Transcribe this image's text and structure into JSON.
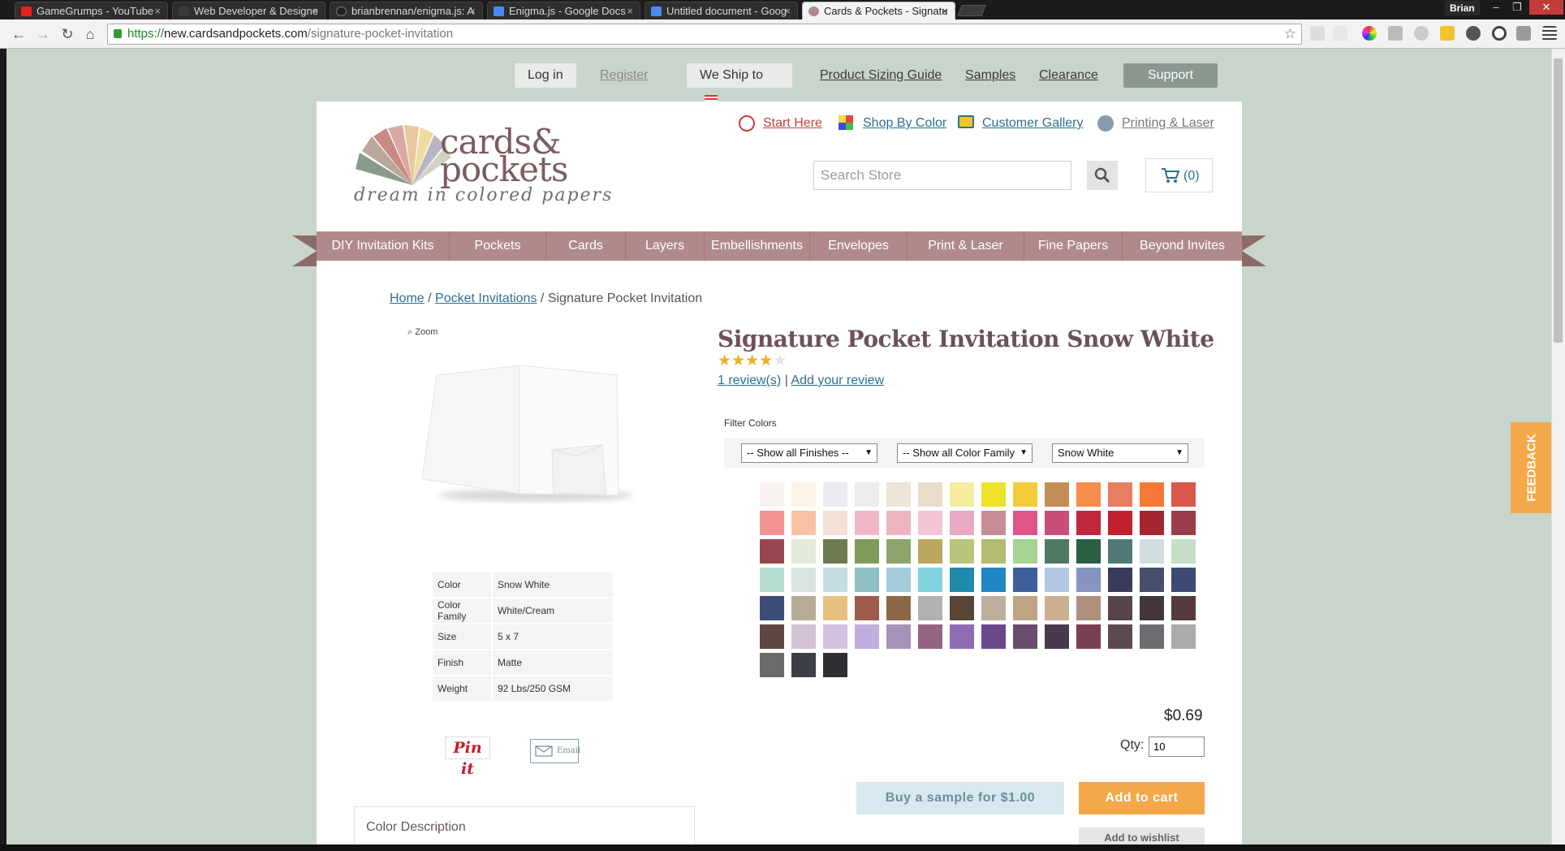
{
  "browser": {
    "tabs": [
      {
        "title": "GameGrumps - YouTube",
        "active": false,
        "favicon_color": "#e62117"
      },
      {
        "title": "Web Developer & Designe",
        "active": false,
        "favicon_color": "#3a3a3a"
      },
      {
        "title": "brianbrennan/enigma.js: A",
        "active": false,
        "favicon_color": "#222222"
      },
      {
        "title": "Enigma.js - Google Docs",
        "active": false,
        "favicon_color": "#4a8af4"
      },
      {
        "title": "Untitled document - Goog",
        "active": false,
        "favicon_color": "#4a8af4"
      },
      {
        "title": "Cards & Pockets - Signatu",
        "active": true,
        "favicon_color": "#b08a8a"
      }
    ],
    "close_glyph": "×",
    "user": "Brian",
    "url_scheme": "https://",
    "url_host": "new.cardsandpockets.com",
    "url_path": "/signature-pocket-invitation"
  },
  "topnav": {
    "login": "Log in",
    "register": "Register",
    "ship": "We Ship to",
    "sizing": "Product Sizing Guide",
    "samples": "Samples",
    "clearance": "Clearance",
    "support": "Support"
  },
  "logo": {
    "line1": "cards&",
    "line2": "pockets",
    "tagline": "dream in colored papers"
  },
  "quicklinks": {
    "start": "Start Here",
    "shop_color": "Shop By Color",
    "gallery": "Customer Gallery",
    "printing": "Printing & Laser"
  },
  "search": {
    "placeholder": "Search Store"
  },
  "cart": {
    "count": "(0)"
  },
  "mainnav": [
    "DIY Invitation Kits",
    "Pockets",
    "Cards",
    "Layers",
    "Embellishments",
    "Envelopes",
    "Print & Laser",
    "Fine Papers",
    "Beyond Invites"
  ],
  "breadcrumb": {
    "home": "Home",
    "sep": "/",
    "category": "Pocket Invitations",
    "current": "Signature Pocket Invitation"
  },
  "product": {
    "zoom": "Zoom",
    "title": "Signature Pocket Invitation Snow White",
    "rating": 4,
    "rating_max": 5,
    "reviews_link": "1 review(s)",
    "reviews_sep": "|",
    "add_review": "Add your review",
    "attributes": [
      {
        "k": "Color",
        "v": "Snow White"
      },
      {
        "k": "Color Family",
        "v": "White/Cream"
      },
      {
        "k": "Size",
        "v": "5 x 7"
      },
      {
        "k": "Finish",
        "v": "Matte"
      },
      {
        "k": "Weight",
        "v": "92 Lbs/250 GSM"
      }
    ],
    "pin": "Pin it",
    "email": "Email",
    "color_description": "Color Description",
    "price": "$0.69",
    "qty_label": "Qty:",
    "qty": "10",
    "sample_btn": "Buy a sample for $1.00",
    "cart_btn": "Add to cart",
    "wishlist_btn": "Add to wishlist"
  },
  "filters": {
    "label": "Filter Colors",
    "finish": "-- Show all Finishes --",
    "family": "-- Show all Color Family --",
    "color": "Snow White"
  },
  "swatches": [
    "#f7f2ef",
    "#faf3e8",
    "#ecebf1",
    "#eeecec",
    "#ece3d9",
    "#e9dcca",
    "#f4eda0",
    "#ece22a",
    "#f2cc3b",
    "#c28e55",
    "#f68f4d",
    "#e57e62",
    "#f57935",
    "#d9574c",
    "#f19492",
    "#f7c2a1",
    "#f2e0d4",
    "#f0b8c7",
    "#f0b4c0",
    "#f5c4d4",
    "#e9a8c3",
    "#c88d94",
    "#e0548a",
    "#c94e78",
    "#c3273f",
    "#c2202f",
    "#a5262f",
    "#9a3d4a",
    "#9a4650",
    "#e3ead9",
    "#6e7a4f",
    "#7f9b5c",
    "#8da46a",
    "#bba75d",
    "#b9c47c",
    "#b4bb73",
    "#a6d493",
    "#4f7861",
    "#2a5f42",
    "#517879",
    "#d3dde1",
    "#c5dfc7",
    "#b5dccc",
    "#d7e4df",
    "#c4dde3",
    "#8ec1c3",
    "#a3cbda",
    "#7fd1dd",
    "#1f8aa9",
    "#2086c4",
    "#3d5f9c",
    "#b3c6e2",
    "#8594c0",
    "#383c59",
    "#494e6a",
    "#3d4a74",
    "#3d4d77",
    "#b8ab95",
    "#e7c080",
    "#9d5c49",
    "#8d6846",
    "#b2b1b0",
    "#574538",
    "#bdae9f",
    "#bfa385",
    "#cab08f",
    "#ae8e7c",
    "#574549",
    "#443638",
    "#553b3c",
    "#5e4643",
    "#d2c3d6",
    "#d5c1e0",
    "#c2ade0",
    "#a692ba",
    "#956383",
    "#8f6cb4",
    "#69488c",
    "#6a4d6d",
    "#483a4e",
    "#793f55",
    "#5e4950",
    "#6e6b71",
    "#ababad",
    "#6b6a6c",
    "#3d3f47",
    "#2f2f33"
  ],
  "feedback": "FEEDBACK"
}
